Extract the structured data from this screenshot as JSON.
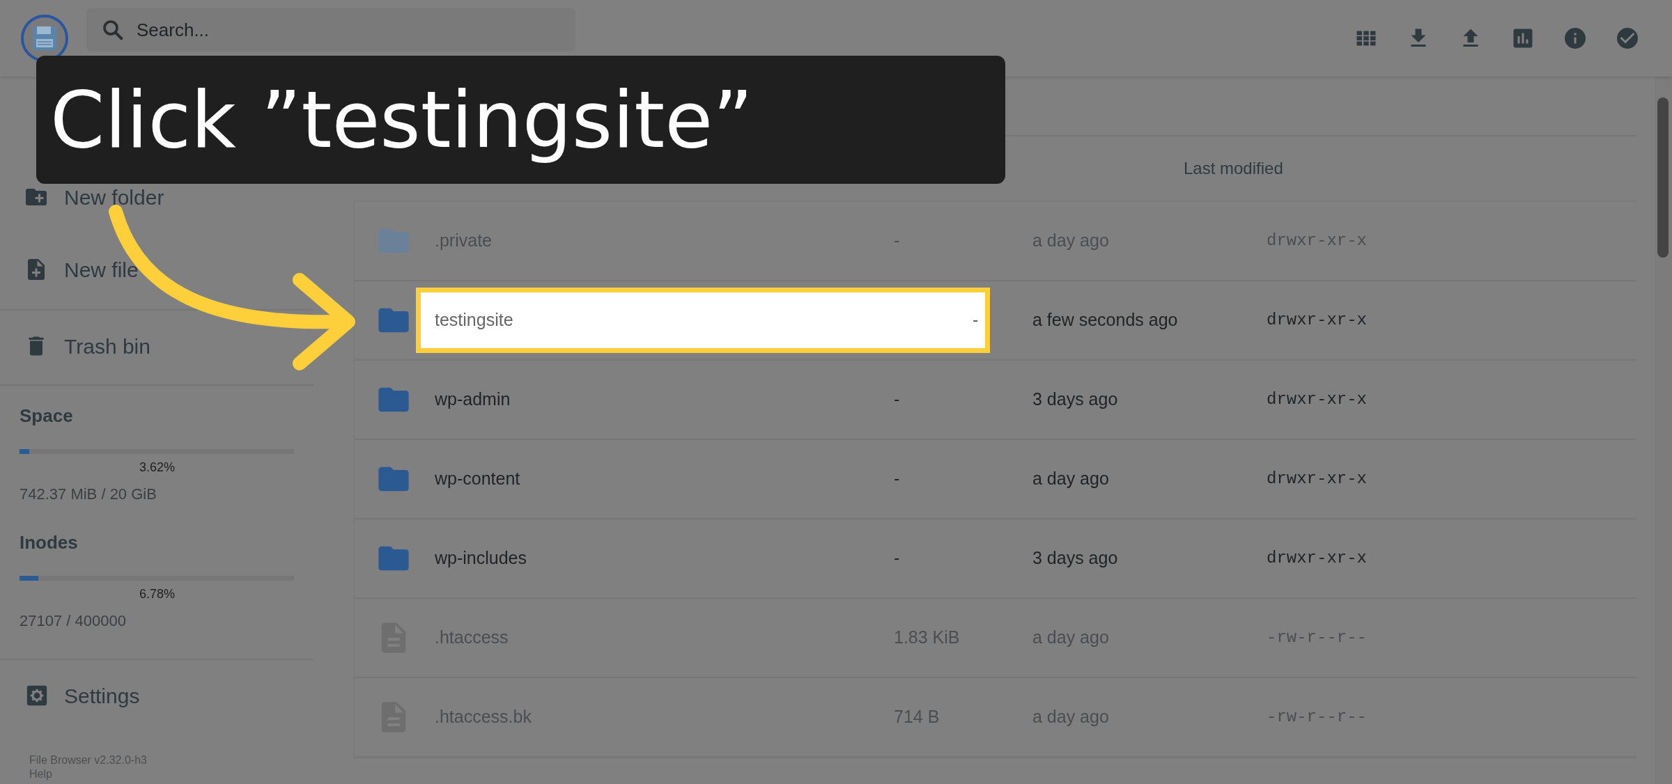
{
  "header": {
    "search": {
      "placeholder": "Search..."
    },
    "actions": [
      {
        "kind": "grid"
      },
      {
        "kind": "download"
      },
      {
        "kind": "upload"
      },
      {
        "kind": "chart"
      },
      {
        "kind": "info"
      },
      {
        "kind": "check"
      }
    ]
  },
  "sidebar": {
    "items": [
      {
        "kind": "new-folder",
        "label": "New folder"
      },
      {
        "kind": "new-file",
        "label": "New file"
      },
      {
        "kind": "trash",
        "label": "Trash bin"
      }
    ],
    "usage": [
      {
        "title": "Space",
        "level": 0.0362,
        "percent": "3.62%",
        "detail": "742.37 MiB / 20 GiB"
      },
      {
        "title": "Inodes",
        "level": 0.0678,
        "percent": "6.78%",
        "detail": "27107 / 400000"
      }
    ],
    "settings": "Settings",
    "footer": [
      "File Browser v2.32.0-h3",
      "Help"
    ]
  },
  "table": {
    "last_modified_header": "Last modified",
    "rows": [
      {
        "kind": "folder",
        "name": ".private",
        "size": "-",
        "modified": "a day ago",
        "permissions": "drwxr-xr-x",
        "faded": true,
        "highlighted": false
      },
      {
        "kind": "folder",
        "name": "testingsite",
        "size": "-",
        "modified": "a few seconds ago",
        "permissions": "drwxr-xr-x",
        "faded": false,
        "highlighted": true
      },
      {
        "kind": "folder",
        "name": "wp-admin",
        "size": "-",
        "modified": "3 days ago",
        "permissions": "drwxr-xr-x",
        "faded": false,
        "highlighted": false
      },
      {
        "kind": "folder",
        "name": "wp-content",
        "size": "-",
        "modified": "a day ago",
        "permissions": "drwxr-xr-x",
        "faded": false,
        "highlighted": false
      },
      {
        "kind": "folder",
        "name": "wp-includes",
        "size": "-",
        "modified": "3 days ago",
        "permissions": "drwxr-xr-x",
        "faded": false,
        "highlighted": false
      },
      {
        "kind": "file",
        "name": ".htaccess",
        "size": "1.83 KiB",
        "modified": "a day ago",
        "permissions": "-rw-r--r--",
        "faded": true,
        "highlighted": false
      },
      {
        "kind": "file",
        "name": ".htaccess.bk",
        "size": "714 B",
        "modified": "a day ago",
        "permissions": "-rw-r--r--",
        "faded": true,
        "highlighted": false
      }
    ]
  },
  "callout": {
    "text": "Click ”testingsite”"
  }
}
